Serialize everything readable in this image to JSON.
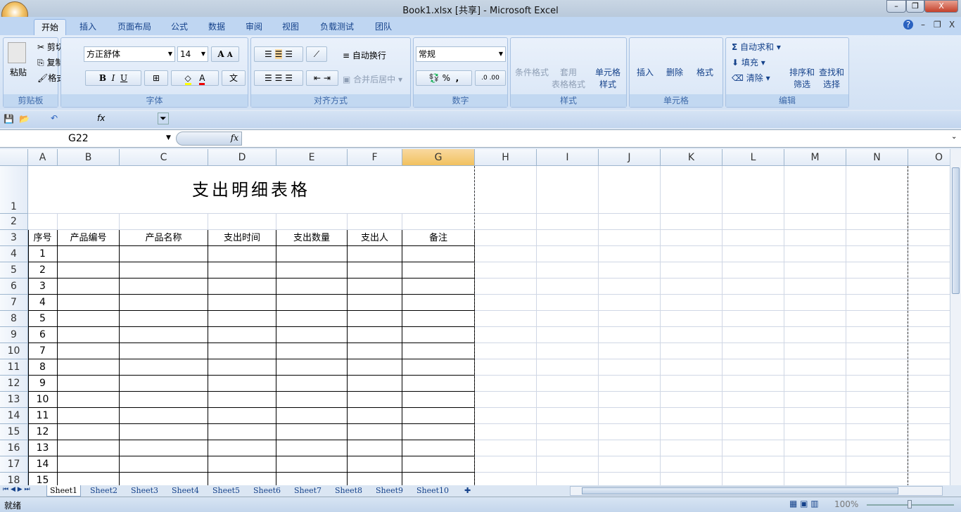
{
  "window": {
    "title": "Book1.xlsx  [共享] - Microsoft Excel",
    "min": "–",
    "restore": "❐",
    "close": "X"
  },
  "ribbon_tabs": [
    "开始",
    "插入",
    "页面布局",
    "公式",
    "数据",
    "审阅",
    "视图",
    "负载测试",
    "团队"
  ],
  "ribbon_right": {
    "help": "?",
    "min": "–",
    "restore": "❐",
    "close": "X"
  },
  "clipboard": {
    "paste": "粘贴",
    "cut": "剪切",
    "copy": "复制",
    "format_painter": "格式刷",
    "label": "剪贴板"
  },
  "font": {
    "name": "方正舒体",
    "size": "14",
    "grow": "A",
    "shrink": "A",
    "bold": "B",
    "italic": "I",
    "underline": "U",
    "phonetic": "文",
    "label": "字体",
    "fill_color": "#ffff00",
    "font_color": "#ff0000"
  },
  "alignment": {
    "wrap": "自动换行",
    "merge": "合并后居中",
    "label": "对齐方式"
  },
  "number": {
    "format": "常规",
    "percent": "%",
    "comma": ",",
    "inc": ".0",
    "dec": ".00",
    "label": "数字"
  },
  "styles": {
    "conditional": "条件格式",
    "table": "套用\n表格格式",
    "cell_styles": "单元格\n样式",
    "label": "样式"
  },
  "cells": {
    "insert": "插入",
    "delete": "删除",
    "format": "格式",
    "label": "单元格"
  },
  "editing": {
    "autosum": "自动求和",
    "fill": "填充",
    "clear": "清除",
    "sort": "排序和\n筛选",
    "find": "查找和\n选择",
    "label": "编辑"
  },
  "formula_bar": {
    "name_box": "G22",
    "fx": "fx",
    "value": ""
  },
  "columns": [
    "A",
    "B",
    "C",
    "D",
    "E",
    "F",
    "G",
    "H",
    "I",
    "J",
    "K",
    "L",
    "M",
    "N",
    "O"
  ],
  "selected_column": "G",
  "sheet": {
    "title": "支出明细表格",
    "headers": [
      "序号",
      "产品编号",
      "产品名称",
      "支出时间",
      "支出数量",
      "支出人",
      "备注"
    ],
    "rows": [
      "1",
      "2",
      "3",
      "4",
      "5",
      "6",
      "7",
      "8",
      "9",
      "10",
      "11",
      "12",
      "13",
      "14",
      "15"
    ],
    "row_numbers": [
      "1",
      "2",
      "3",
      "4",
      "5",
      "6",
      "7",
      "8",
      "9",
      "10",
      "11",
      "12",
      "13",
      "14",
      "15",
      "16",
      "17",
      "18"
    ]
  },
  "sheet_tabs": [
    "Sheet1",
    "Sheet2",
    "Sheet3",
    "Sheet4",
    "Sheet5",
    "Sheet6",
    "Sheet7",
    "Sheet8",
    "Sheet9",
    "Sheet10"
  ],
  "active_sheet": "Sheet1",
  "status": {
    "ready": "就绪",
    "zoom": "100%"
  }
}
